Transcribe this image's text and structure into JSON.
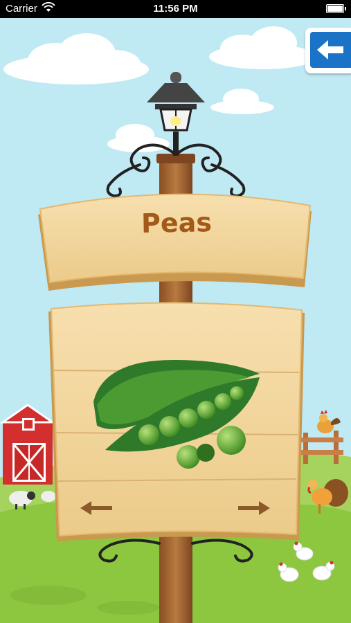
{
  "status_bar": {
    "carrier": "Carrier",
    "time": "11:56 PM",
    "wifi_icon": "wifi-icon",
    "battery_icon": "battery-icon"
  },
  "back_button": {
    "icon": "arrow-left-icon",
    "color": "#1a73c6"
  },
  "sign": {
    "title": "Peas",
    "image_subject": "pea pod with peas"
  },
  "navigation": {
    "previous_icon": "arrow-left-icon",
    "next_icon": "arrow-right-icon"
  },
  "colors": {
    "sky": "#bfe9f3",
    "grass": "#8dc63f",
    "wood": "#f2d49b",
    "title_text": "#a35a18",
    "arrow": "#8b5a2b"
  }
}
